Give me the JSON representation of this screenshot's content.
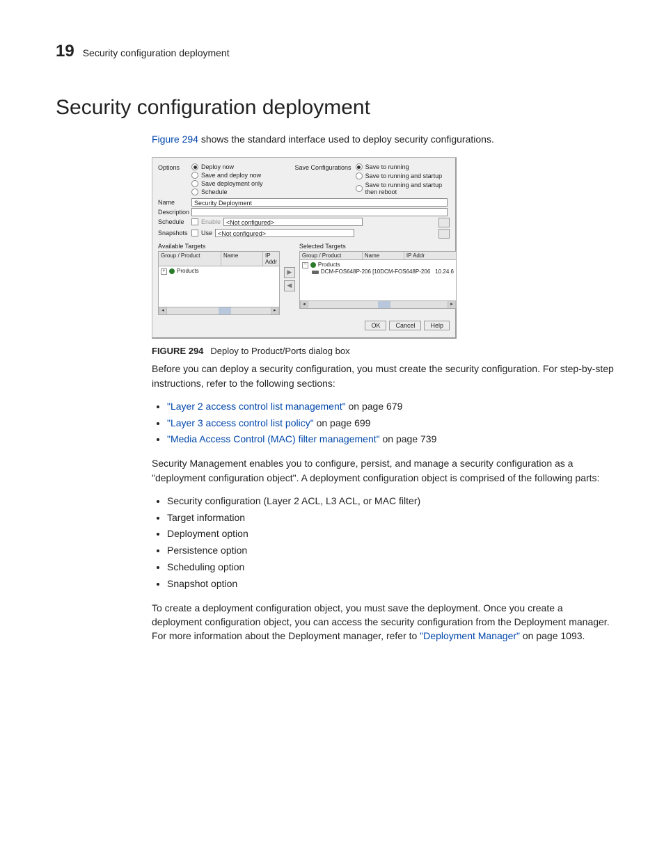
{
  "header": {
    "chapter": "19",
    "running": "Security configuration deployment"
  },
  "title": "Security configuration deployment",
  "intro": {
    "figref": "Figure 294",
    "rest": " shows the standard interface used to deploy security configurations."
  },
  "dialog": {
    "options_label": "Options",
    "options": {
      "deploy_now": "Deploy now",
      "save_deploy_now": "Save and deploy now",
      "save_only": "Save deployment only",
      "schedule": "Schedule"
    },
    "save_config_label": "Save Configurations",
    "save_configs": {
      "to_running": "Save to running",
      "running_startup": "Save to running and startup",
      "running_startup_reboot": "Save to running and startup then reboot"
    },
    "name_label": "Name",
    "name_value": "Security Deployment",
    "description_label": "Description",
    "schedule_label": "Schedule",
    "schedule_enable": "Enable",
    "not_configured": "<Not configured>",
    "snapshots_label": "Snapshots",
    "snapshots_use": "Use",
    "available_targets": "Available Targets",
    "selected_targets": "Selected Targets",
    "col_group": "Group / Product",
    "col_name": "Name",
    "col_ip": "IP Addr",
    "products": "Products",
    "selected_item": "DCM-FOS648P-206 [10DCM-FOS648P-206",
    "selected_ip": "10.24.6",
    "ok": "OK",
    "cancel": "Cancel",
    "help": "Help"
  },
  "caption": {
    "label": "FIGURE 294",
    "text": "Deploy to Product/Ports dialog box"
  },
  "para2": "Before you can deploy a security configuration, you must create the security configuration. For step-by-step instructions, refer to the following sections:",
  "links": {
    "l2": {
      "text": "\"Layer 2 access control list management\"",
      "tail": " on page 679"
    },
    "l3": {
      "text": "\"Layer 3 access control list policy\"",
      "tail": " on page 699"
    },
    "mac": {
      "text": "\"Media Access Control (MAC) filter management\"",
      "tail": " on page 739"
    }
  },
  "para3": "Security Management enables you to configure, persist, and manage a security configuration as a \"deployment configuration object\". A deployment configuration object is comprised of the following parts:",
  "parts": [
    "Security configuration (Layer 2 ACL, L3 ACL, or MAC filter)",
    "Target information",
    "Deployment option",
    "Persistence option",
    "Scheduling option",
    "Snapshot option"
  ],
  "para4a": "To create a deployment configuration object, you must save the deployment. Once you create a deployment configuration object, you can access the security configuration from the Deployment manager. For more information about the Deployment manager, refer to ",
  "para4link": "\"Deployment Manager\"",
  "para4b": " on page 1093."
}
